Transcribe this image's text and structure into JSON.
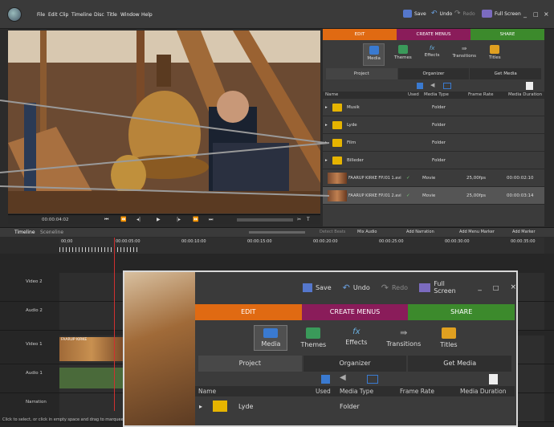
{
  "menubar": {
    "items": [
      "File",
      "Edit",
      "Clip",
      "Timeline",
      "Disc",
      "Title",
      "Window",
      "Help"
    ],
    "save": "Save",
    "undo": "Undo",
    "redo": "Redo",
    "fullscreen": "Full Screen"
  },
  "preview": {
    "timecode": "00:00:04:02"
  },
  "panel": {
    "tabs": [
      "EDIT",
      "CREATE MENUS",
      "SHARE"
    ],
    "icons": [
      "Media",
      "Themes",
      "Effects",
      "Transitions",
      "Titles"
    ],
    "subtabs": [
      "Project",
      "Organizer",
      "Get Media"
    ],
    "columns": [
      "Name",
      "Used",
      "Media Type",
      "Frame Rate",
      "Media Duration"
    ],
    "rows": [
      {
        "name": "Musik",
        "type": "Folder",
        "rate": "",
        "dur": "",
        "used": ""
      },
      {
        "name": "Lyde",
        "type": "Folder",
        "rate": "",
        "dur": "",
        "used": ""
      },
      {
        "name": "Film",
        "type": "Folder",
        "rate": "",
        "dur": "",
        "used": ""
      },
      {
        "name": "Billeder",
        "type": "Folder",
        "rate": "",
        "dur": "",
        "used": ""
      },
      {
        "name": "FAARUP KIRKE FP.I01 1.avi",
        "type": "Movie",
        "rate": "25,00fps",
        "dur": "00:00:02:10",
        "used": "✓"
      },
      {
        "name": "FAARUP KIRKE FP.I01 2.avi",
        "type": "Movie",
        "rate": "25,00fps",
        "dur": "00:00:03:14",
        "used": "✓"
      }
    ]
  },
  "timeline": {
    "tabs": [
      "Timeline",
      "Sceneline"
    ],
    "actions": [
      "Detect Beats",
      "Mix Audio",
      "Add Narration",
      "Add Menu Marker",
      "Add Marker"
    ],
    "ruler": [
      "00;00",
      "00:00:05:00",
      "00:00:10:00",
      "00:00:15:00",
      "00:00:20:00",
      "00:00:25:00",
      "00:00:30:00",
      "00:00:35:00"
    ],
    "tracks": [
      "Video 2",
      "Audio 2",
      "Video 1",
      "Audio 1",
      "Narration"
    ],
    "clip": "FAARUP KIRKE",
    "status": "Click to select, or click in empty space and drag to marquee select"
  },
  "zoom": {
    "save": "Save",
    "undo": "Undo",
    "redo": "Redo",
    "fullscreen": "Full Screen",
    "tabs": [
      "EDIT",
      "CREATE MENUS",
      "SHARE"
    ],
    "icons": [
      "Media",
      "Themes",
      "Effects",
      "Transitions",
      "Titles"
    ],
    "subtabs": [
      "Project",
      "Organizer",
      "Get Media"
    ],
    "columns": [
      "Name",
      "Used",
      "Media Type",
      "Frame Rate",
      "Media Duration"
    ],
    "row": {
      "name": "Lyde",
      "type": "Folder"
    }
  }
}
